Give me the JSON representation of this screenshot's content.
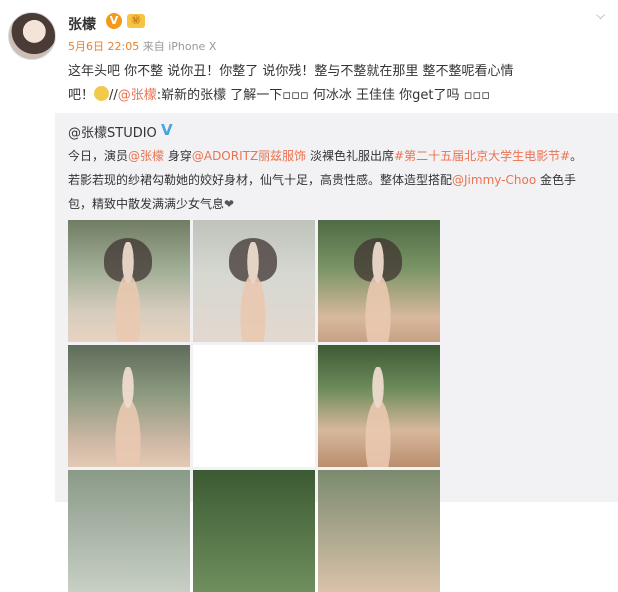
{
  "user": {
    "name": "张檬",
    "verified_badge": "V",
    "crown_badge": "㊙"
  },
  "meta": {
    "time": "5月6日 22:05",
    "source": "来自 iPhone X"
  },
  "post": {
    "line1": "这年头吧 你不整  说你丑！你整了  说你残！整与不整就在那里  整不整呢看心情",
    "line2_prefix": "吧！",
    "line2_emoji": "🙀",
    "line2_sep": "//",
    "line2_mention": "@张檬",
    "line2_rest": ":崭新的张檬  了解一下▫▫▫ 何冰冰 王佳佳 你get了吗 ▫▫▫"
  },
  "repost": {
    "author": "@张檬STUDIO",
    "author_badge": "V",
    "t1": "今日，演员",
    "m1": "@张檬",
    "t2": " 身穿",
    "m2": "@ADORITZ丽兹服饰",
    "t3": " 淡裸色礼服出席",
    "m3": "#第二十五届北京大学生电影节#",
    "t4": "。",
    "t5": "若影若现的纱裙勾勒她的姣好身材，仙气十足，高贵性感。整体造型搭配",
    "m4": "@Jimmy-Choo",
    "t6": " 金色手",
    "t7": "包，精致中散发满满少女气息",
    "heart": "❤"
  },
  "header": {
    "chevron": "⌵"
  }
}
